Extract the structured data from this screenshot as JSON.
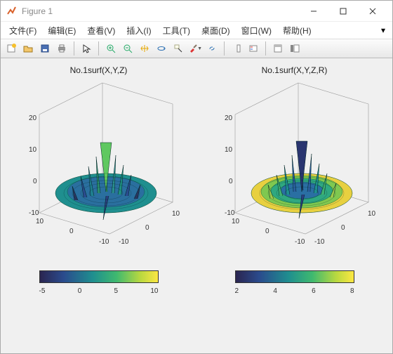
{
  "window": {
    "title": "Figure 1"
  },
  "menus": {
    "file": "文件(F)",
    "edit": "编辑(E)",
    "view": "查看(V)",
    "insert": "插入(I)",
    "tools": "工具(T)",
    "desktop": "桌面(D)",
    "window": "窗口(W)",
    "help": "帮助(H)"
  },
  "toolbar_icons": {
    "new": "new-icon",
    "open": "open-icon",
    "save": "save-icon",
    "print": "print-icon",
    "pointer": "pointer-icon",
    "zoomin": "zoom-in-icon",
    "zoomout": "zoom-out-icon",
    "pan": "pan-icon",
    "rotate": "rotate3d-icon",
    "datacursor": "data-cursor-icon",
    "brush": "brush-icon",
    "link": "link-icon",
    "colorbar": "insert-colorbar-icon",
    "legend": "insert-legend-icon",
    "hide": "hide-tools-icon",
    "dock": "dock-icon"
  },
  "chart_data": [
    {
      "type": "surface3d",
      "title": "No.1surf(X,Y,Z)",
      "xlabel": "",
      "ylabel": "",
      "zlabel": "",
      "xlim": [
        -10,
        10
      ],
      "ylim": [
        -10,
        10
      ],
      "zlim": [
        -10,
        20
      ],
      "x_ticks": [
        -10,
        0,
        10
      ],
      "y_ticks": [
        -10,
        0,
        10
      ],
      "z_ticks": [
        -10,
        0,
        10,
        20
      ],
      "colormap": "parula",
      "color_range": [
        -7,
        12
      ],
      "colorbar_ticks": [
        -5,
        0,
        5,
        10
      ],
      "description": "surf(X,Y,Z) where X,Y are meshgrid(-10:10) and Z is a spiky radial function; surface colored by Z"
    },
    {
      "type": "surface3d",
      "title": "No.1surf(X,Y,Z,R)",
      "xlabel": "",
      "ylabel": "",
      "zlabel": "",
      "xlim": [
        -10,
        10
      ],
      "ylim": [
        -10,
        10
      ],
      "zlim": [
        -10,
        20
      ],
      "x_ticks": [
        -10,
        0,
        10
      ],
      "y_ticks": [
        -10,
        0,
        10
      ],
      "z_ticks": [
        -10,
        0,
        10,
        20
      ],
      "colormap": "parula",
      "color_range": [
        1,
        9
      ],
      "colorbar_ticks": [
        2,
        4,
        6,
        8
      ],
      "description": "surf(X,Y,Z,R) — same geometry as left plot but colored by R = sqrt(X^2+Y^2)"
    }
  ]
}
